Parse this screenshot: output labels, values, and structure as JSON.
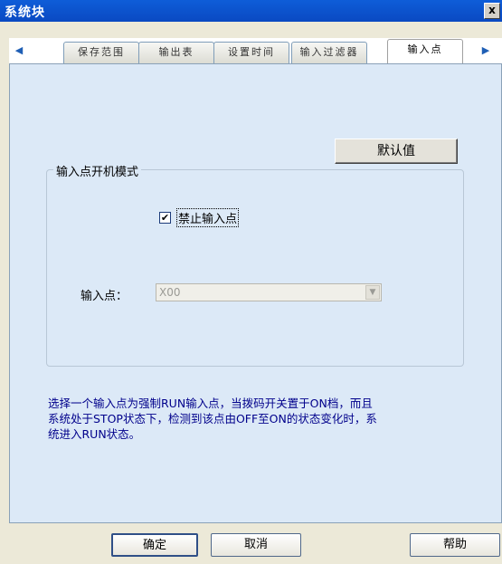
{
  "window": {
    "title": "系统块",
    "close_label": "x"
  },
  "tabs": {
    "prev_label": "◀",
    "next_label": "▶",
    "items": [
      {
        "label": "保存范围"
      },
      {
        "label": "输出表"
      },
      {
        "label": "设置时间"
      },
      {
        "label": "输入过滤器"
      },
      {
        "label": "输入点"
      }
    ],
    "active_index": 4
  },
  "panel": {
    "default_button": "默认值",
    "group_title": "输入点开机模式",
    "checkbox": {
      "label": "禁止输入点",
      "checked": true,
      "mark": "✔"
    },
    "input_point_label": "输入点：",
    "input_point_value": "X00",
    "combo_arrow": "▼",
    "description": [
      "选择一个输入点为强制RUN输入点，当拨码开关置于ON档，而且",
      "系统处于STOP状态下，检测到该点由OFF至ON的状态变化时，系",
      "统进入RUN状态。"
    ]
  },
  "footer": {
    "ok": "确定",
    "cancel": "取消",
    "help": "帮助"
  }
}
